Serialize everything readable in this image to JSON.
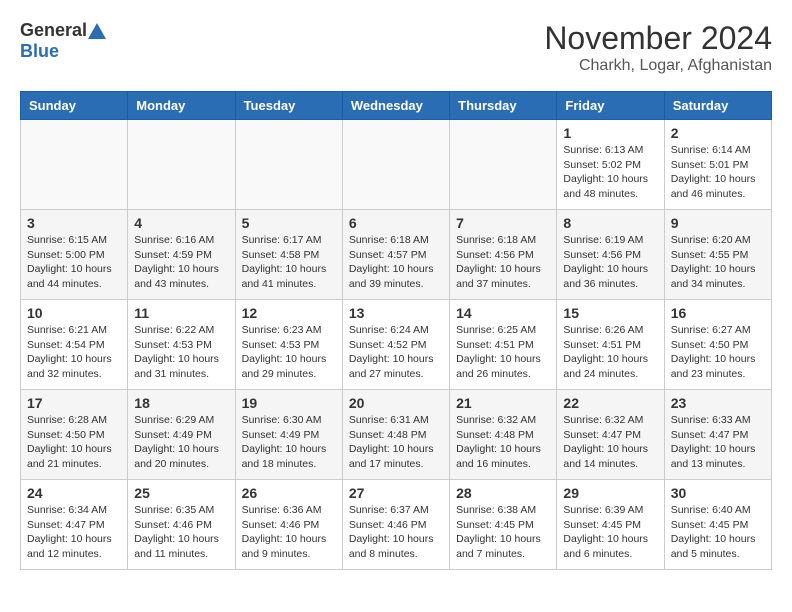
{
  "header": {
    "logo_general": "General",
    "logo_blue": "Blue",
    "month": "November 2024",
    "location": "Charkh, Logar, Afghanistan"
  },
  "days_of_week": [
    "Sunday",
    "Monday",
    "Tuesday",
    "Wednesday",
    "Thursday",
    "Friday",
    "Saturday"
  ],
  "weeks": [
    [
      {
        "num": "",
        "detail": ""
      },
      {
        "num": "",
        "detail": ""
      },
      {
        "num": "",
        "detail": ""
      },
      {
        "num": "",
        "detail": ""
      },
      {
        "num": "",
        "detail": ""
      },
      {
        "num": "1",
        "detail": "Sunrise: 6:13 AM\nSunset: 5:02 PM\nDaylight: 10 hours\nand 48 minutes."
      },
      {
        "num": "2",
        "detail": "Sunrise: 6:14 AM\nSunset: 5:01 PM\nDaylight: 10 hours\nand 46 minutes."
      }
    ],
    [
      {
        "num": "3",
        "detail": "Sunrise: 6:15 AM\nSunset: 5:00 PM\nDaylight: 10 hours\nand 44 minutes."
      },
      {
        "num": "4",
        "detail": "Sunrise: 6:16 AM\nSunset: 4:59 PM\nDaylight: 10 hours\nand 43 minutes."
      },
      {
        "num": "5",
        "detail": "Sunrise: 6:17 AM\nSunset: 4:58 PM\nDaylight: 10 hours\nand 41 minutes."
      },
      {
        "num": "6",
        "detail": "Sunrise: 6:18 AM\nSunset: 4:57 PM\nDaylight: 10 hours\nand 39 minutes."
      },
      {
        "num": "7",
        "detail": "Sunrise: 6:18 AM\nSunset: 4:56 PM\nDaylight: 10 hours\nand 37 minutes."
      },
      {
        "num": "8",
        "detail": "Sunrise: 6:19 AM\nSunset: 4:56 PM\nDaylight: 10 hours\nand 36 minutes."
      },
      {
        "num": "9",
        "detail": "Sunrise: 6:20 AM\nSunset: 4:55 PM\nDaylight: 10 hours\nand 34 minutes."
      }
    ],
    [
      {
        "num": "10",
        "detail": "Sunrise: 6:21 AM\nSunset: 4:54 PM\nDaylight: 10 hours\nand 32 minutes."
      },
      {
        "num": "11",
        "detail": "Sunrise: 6:22 AM\nSunset: 4:53 PM\nDaylight: 10 hours\nand 31 minutes."
      },
      {
        "num": "12",
        "detail": "Sunrise: 6:23 AM\nSunset: 4:53 PM\nDaylight: 10 hours\nand 29 minutes."
      },
      {
        "num": "13",
        "detail": "Sunrise: 6:24 AM\nSunset: 4:52 PM\nDaylight: 10 hours\nand 27 minutes."
      },
      {
        "num": "14",
        "detail": "Sunrise: 6:25 AM\nSunset: 4:51 PM\nDaylight: 10 hours\nand 26 minutes."
      },
      {
        "num": "15",
        "detail": "Sunrise: 6:26 AM\nSunset: 4:51 PM\nDaylight: 10 hours\nand 24 minutes."
      },
      {
        "num": "16",
        "detail": "Sunrise: 6:27 AM\nSunset: 4:50 PM\nDaylight: 10 hours\nand 23 minutes."
      }
    ],
    [
      {
        "num": "17",
        "detail": "Sunrise: 6:28 AM\nSunset: 4:50 PM\nDaylight: 10 hours\nand 21 minutes."
      },
      {
        "num": "18",
        "detail": "Sunrise: 6:29 AM\nSunset: 4:49 PM\nDaylight: 10 hours\nand 20 minutes."
      },
      {
        "num": "19",
        "detail": "Sunrise: 6:30 AM\nSunset: 4:49 PM\nDaylight: 10 hours\nand 18 minutes."
      },
      {
        "num": "20",
        "detail": "Sunrise: 6:31 AM\nSunset: 4:48 PM\nDaylight: 10 hours\nand 17 minutes."
      },
      {
        "num": "21",
        "detail": "Sunrise: 6:32 AM\nSunset: 4:48 PM\nDaylight: 10 hours\nand 16 minutes."
      },
      {
        "num": "22",
        "detail": "Sunrise: 6:32 AM\nSunset: 4:47 PM\nDaylight: 10 hours\nand 14 minutes."
      },
      {
        "num": "23",
        "detail": "Sunrise: 6:33 AM\nSunset: 4:47 PM\nDaylight: 10 hours\nand 13 minutes."
      }
    ],
    [
      {
        "num": "24",
        "detail": "Sunrise: 6:34 AM\nSunset: 4:47 PM\nDaylight: 10 hours\nand 12 minutes."
      },
      {
        "num": "25",
        "detail": "Sunrise: 6:35 AM\nSunset: 4:46 PM\nDaylight: 10 hours\nand 11 minutes."
      },
      {
        "num": "26",
        "detail": "Sunrise: 6:36 AM\nSunset: 4:46 PM\nDaylight: 10 hours\nand 9 minutes."
      },
      {
        "num": "27",
        "detail": "Sunrise: 6:37 AM\nSunset: 4:46 PM\nDaylight: 10 hours\nand 8 minutes."
      },
      {
        "num": "28",
        "detail": "Sunrise: 6:38 AM\nSunset: 4:45 PM\nDaylight: 10 hours\nand 7 minutes."
      },
      {
        "num": "29",
        "detail": "Sunrise: 6:39 AM\nSunset: 4:45 PM\nDaylight: 10 hours\nand 6 minutes."
      },
      {
        "num": "30",
        "detail": "Sunrise: 6:40 AM\nSunset: 4:45 PM\nDaylight: 10 hours\nand 5 minutes."
      }
    ]
  ]
}
